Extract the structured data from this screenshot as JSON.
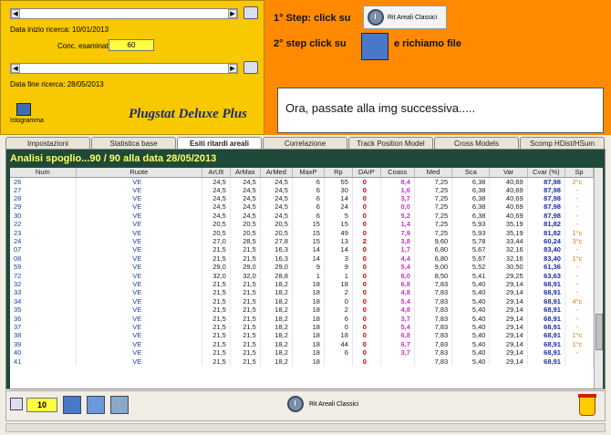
{
  "topleft": {
    "data_inizio_label": "Data inizio ricerca: 10/01/2013",
    "conc_label": "Conc. esaminati",
    "conc_value": "60",
    "data_fine_label": "Data fine ricerca: 28/05/2013",
    "istogramma_label": "Istogramma",
    "brand": "Plugstat Deluxe Plus"
  },
  "topright": {
    "step1": "1° Step: click su",
    "step1_button": "Rit Areali Classici",
    "step2": "2° step click su",
    "step2_suffix": "e richiamo file",
    "message": "Ora, passate alla img successiva....."
  },
  "tabs": [
    {
      "label": "Impostazioni"
    },
    {
      "label": "Statistica base"
    },
    {
      "label": "Esiti ritardi areali"
    },
    {
      "label": "Correlazione"
    },
    {
      "label": "Track Position Model"
    },
    {
      "label": "Cross Models"
    },
    {
      "label": "Scomp HDist/HSum"
    }
  ],
  "panel_title": "Analisi spoglio...90 / 90 alla data 28/05/2013",
  "columns": [
    "Num",
    "Ruote",
    "ArUlt",
    "ArMax",
    "ArMed",
    "MaxP",
    "Rp",
    "DArP",
    "Coass",
    "Med",
    "Sca",
    "Var",
    "Cvar (%)",
    "Sp"
  ],
  "rows": [
    [
      "26",
      "VE",
      "24,5",
      "24,5",
      "24,5",
      "6",
      "55",
      "0",
      "8,4",
      "7,25",
      "6,38",
      "40,69",
      "87,98",
      "2°c"
    ],
    [
      "27",
      "VE",
      "24,5",
      "24,5",
      "24,5",
      "6",
      "30",
      "0",
      "1,6",
      "7,25",
      "6,38",
      "40,69",
      "87,98",
      "-"
    ],
    [
      "28",
      "VE",
      "24,5",
      "24,5",
      "24,5",
      "6",
      "14",
      "0",
      "3,7",
      "7,25",
      "6,38",
      "40,69",
      "87,98",
      "-"
    ],
    [
      "29",
      "VE",
      "24,5",
      "24,5",
      "24,5",
      "6",
      "24",
      "0",
      "0,0",
      "7,25",
      "6,38",
      "40,69",
      "87,98",
      "-"
    ],
    [
      "30",
      "VE",
      "24,5",
      "24,5",
      "24,5",
      "6",
      "5",
      "0",
      "5,2",
      "7,25",
      "6,38",
      "40,69",
      "87,98",
      "-"
    ],
    [
      "22",
      "VE",
      "20,5",
      "20,5",
      "20,5",
      "15",
      "15",
      "0",
      "1,4",
      "7,25",
      "5,93",
      "35,19",
      "81,82",
      "-"
    ],
    [
      "23",
      "VE",
      "20,5",
      "20,5",
      "20,5",
      "15",
      "49",
      "0",
      "7,9",
      "7,25",
      "5,93",
      "35,19",
      "81,82",
      "1°c"
    ],
    [
      "24",
      "VE",
      "27,0",
      "28,5",
      "27,8",
      "15",
      "13",
      "2",
      "3,8",
      "9,60",
      "5,78",
      "33,44",
      "60,24",
      "3°c"
    ],
    [
      "07",
      "VE",
      "21,5",
      "21,5",
      "16,3",
      "14",
      "14",
      "0",
      "1,7",
      "6,80",
      "5,67",
      "32,16",
      "83,40",
      "-"
    ],
    [
      "08",
      "VE",
      "21,5",
      "21,5",
      "16,3",
      "14",
      "3",
      "0",
      "4,4",
      "6,80",
      "5,67",
      "32,16",
      "83,40",
      "1°c"
    ],
    [
      "59",
      "VE",
      "29,0",
      "29,0",
      "29,0",
      "9",
      "9",
      "0",
      "5,4",
      "9,00",
      "5,52",
      "30,50",
      "61,36",
      "-"
    ],
    [
      "72",
      "VE",
      "32,0",
      "32,0",
      "28,8",
      "1",
      "1",
      "0",
      "8,0",
      "8,50",
      "5,41",
      "29,25",
      "63,63",
      "-"
    ],
    [
      "32",
      "VE",
      "21,5",
      "21,5",
      "18,2",
      "18",
      "18",
      "0",
      "6,8",
      "7,83",
      "5,40",
      "29,14",
      "68,91",
      "-"
    ],
    [
      "33",
      "VE",
      "21,5",
      "21,5",
      "18,2",
      "18",
      "2",
      "0",
      "4,8",
      "7,83",
      "5,40",
      "29,14",
      "68,91",
      "-"
    ],
    [
      "34",
      "VE",
      "21,5",
      "21,5",
      "18,2",
      "18",
      "0",
      "0",
      "5,4",
      "7,83",
      "5,40",
      "29,14",
      "68,91",
      "4°c"
    ],
    [
      "35",
      "VE",
      "21,5",
      "21,5",
      "18,2",
      "18",
      "2",
      "0",
      "4,8",
      "7,83",
      "5,40",
      "29,14",
      "68,91",
      "-"
    ],
    [
      "36",
      "VE",
      "21,5",
      "21,5",
      "18,2",
      "18",
      "6",
      "0",
      "3,7",
      "7,83",
      "5,40",
      "29,14",
      "68,91",
      "-"
    ],
    [
      "37",
      "VE",
      "21,5",
      "21,5",
      "18,2",
      "18",
      "0",
      "0",
      "5,4",
      "7,83",
      "5,40",
      "29,14",
      "68,91",
      "-"
    ],
    [
      "38",
      "VE",
      "21,5",
      "21,5",
      "18,2",
      "18",
      "18",
      "0",
      "6,8",
      "7,83",
      "5,40",
      "29,14",
      "68,91",
      "1°c"
    ],
    [
      "39",
      "VE",
      "21,5",
      "21,5",
      "18,2",
      "18",
      "44",
      "0",
      "6,7",
      "7,83",
      "5,40",
      "29,14",
      "68,91",
      "1°c"
    ],
    [
      "40",
      "VE",
      "21,5",
      "21,5",
      "18,2",
      "18",
      "6",
      "0",
      "3,7",
      "7,83",
      "5,40",
      "29,14",
      "68,91",
      "-"
    ],
    [
      "41",
      "VE",
      "21,5",
      "21,5",
      "18,2",
      "18",
      "",
      "0",
      "",
      "7,83",
      "5,40",
      "29,14",
      "68,91",
      ""
    ]
  ],
  "bottom": {
    "count_value": "10",
    "rit_button": "Rit Areali Classici"
  },
  "colors": {
    "top_left_bg": "#f8c800",
    "top_right_bg": "#ff8a00",
    "panel_bg": "#1f4a3a",
    "title_yellow": "#ffff60"
  }
}
